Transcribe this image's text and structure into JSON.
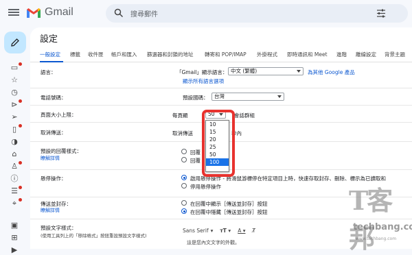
{
  "app": {
    "name": "Gmail"
  },
  "search": {
    "placeholder": "搜尋郵件"
  },
  "settings": {
    "title": "設定"
  },
  "tabs": [
    {
      "label": "一般設定"
    },
    {
      "label": "標籤"
    },
    {
      "label": "收件匣"
    },
    {
      "label": "帳戶和匯入"
    },
    {
      "label": "篩選器和封鎖的地址"
    },
    {
      "label": "轉寄和 POP/IMAP"
    },
    {
      "label": "外掛程式"
    },
    {
      "label": "即時通訊和 Meet"
    },
    {
      "label": "進階"
    },
    {
      "label": "離線設定"
    },
    {
      "label": "背景主題"
    }
  ],
  "rows": {
    "language": {
      "label": "語言：",
      "text_prefix": "「Gmail」顯示語言：",
      "select_value": "中文 (繁體)",
      "link": "為其他 Google 產品",
      "show_all": "顯示所有語言選項"
    },
    "phone": {
      "label": "電話號碼：",
      "text": "預設國碼：",
      "select_value": "台灣"
    },
    "page_size": {
      "label": "頁面大小上限：",
      "prefix": "每頁顯",
      "select_value": "50",
      "suffix": "會話群組"
    },
    "undo_send": {
      "label": "取消傳送：",
      "prefix": "取消傳送",
      "suffix": "秒內"
    },
    "reply": {
      "label": "預設的回覆樣式：",
      "sublink": "瞭解詳情",
      "option1": "回覆",
      "option2": "回覆"
    },
    "hover": {
      "label": "懸停操作：",
      "option1": "啟用懸停操作 - 將滑鼠游標停在特定項目上時，快速存取封存、刪除、標示為已讀取和",
      "option2": "停用懸停操作"
    },
    "send_archive": {
      "label": "傳送並封存：",
      "sublink": "瞭解詳情",
      "option1": "在回覆中顯示［傳送並封存］按鈕",
      "option2": "在回覆中隱藏［傳送並封存］按鈕"
    },
    "default_text": {
      "label": "預設文字樣式：",
      "hint": "(使用工具列上的「移除格式」按鈕重設預設文字樣式)",
      "font": "Sans Serif",
      "sample": "這是您內文文字的外觀。"
    }
  },
  "dropdown": {
    "options": [
      "10",
      "15",
      "20",
      "25",
      "50",
      "100"
    ],
    "highlighted": "100"
  },
  "watermark": {
    "cn": "T客邦",
    "en": "techbang.com",
    "url": "www.techbang.com"
  },
  "colors": {
    "accent": "#0b57d0",
    "highlight": "#1a73e8",
    "callout": "#e8322e",
    "compose": "#c2e7ff"
  }
}
